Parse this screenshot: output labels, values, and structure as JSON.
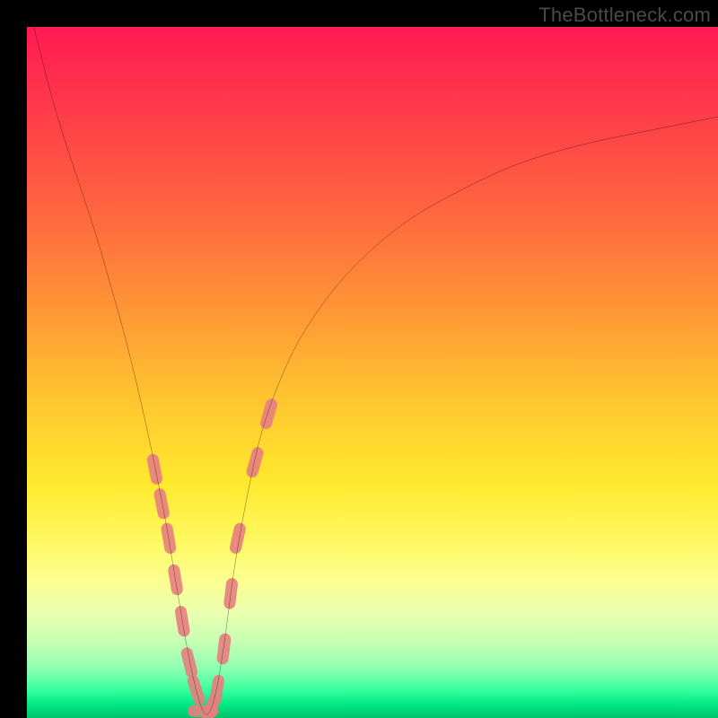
{
  "attribution": "TheBottleneck.com",
  "colors": {
    "frame": "#000000",
    "curve": "#000000",
    "marker": "#e77f7f",
    "gradient_top": "#ff1a52",
    "gradient_bottom": "#00c46b"
  },
  "chart_data": {
    "type": "line",
    "title": "",
    "xlabel": "",
    "ylabel": "",
    "xlim": [
      0,
      100
    ],
    "ylim": [
      0,
      100
    ],
    "grid": false,
    "legend": false,
    "notes": "Bottleneck-style V curve. Axes have no visible tick labels; x and y are normalized 0–100. Lower y is better (green). Curve minimum near x≈25 at y≈0. Pink segments highlight points along the descending and ascending portions near the trough.",
    "series": [
      {
        "name": "curve",
        "x": [
          1,
          3,
          5,
          8,
          10,
          12,
          14,
          16,
          18,
          19,
          20,
          21,
          22,
          23,
          24,
          25,
          26,
          27,
          28,
          29,
          30,
          32,
          34,
          37,
          40,
          45,
          50,
          55,
          60,
          70,
          80,
          90,
          100
        ],
        "y": [
          100,
          92,
          85,
          76,
          70,
          63,
          56,
          48,
          39,
          34,
          29,
          23,
          17,
          11,
          6,
          2,
          0,
          2,
          7,
          14,
          22,
          33,
          42,
          50,
          56,
          63,
          68,
          72,
          75,
          80,
          83,
          85,
          87
        ]
      }
    ],
    "highlighted_points": {
      "name": "markers",
      "x": [
        18.5,
        19.5,
        20.5,
        21.5,
        22.5,
        23.5,
        24.5,
        25.5,
        26.5,
        27.5,
        28.5,
        29.5,
        30.5,
        33.0,
        35.0
      ],
      "y": [
        36,
        31,
        26,
        20,
        14,
        8,
        4,
        1,
        1,
        4,
        10,
        18,
        26,
        37,
        44
      ]
    }
  }
}
